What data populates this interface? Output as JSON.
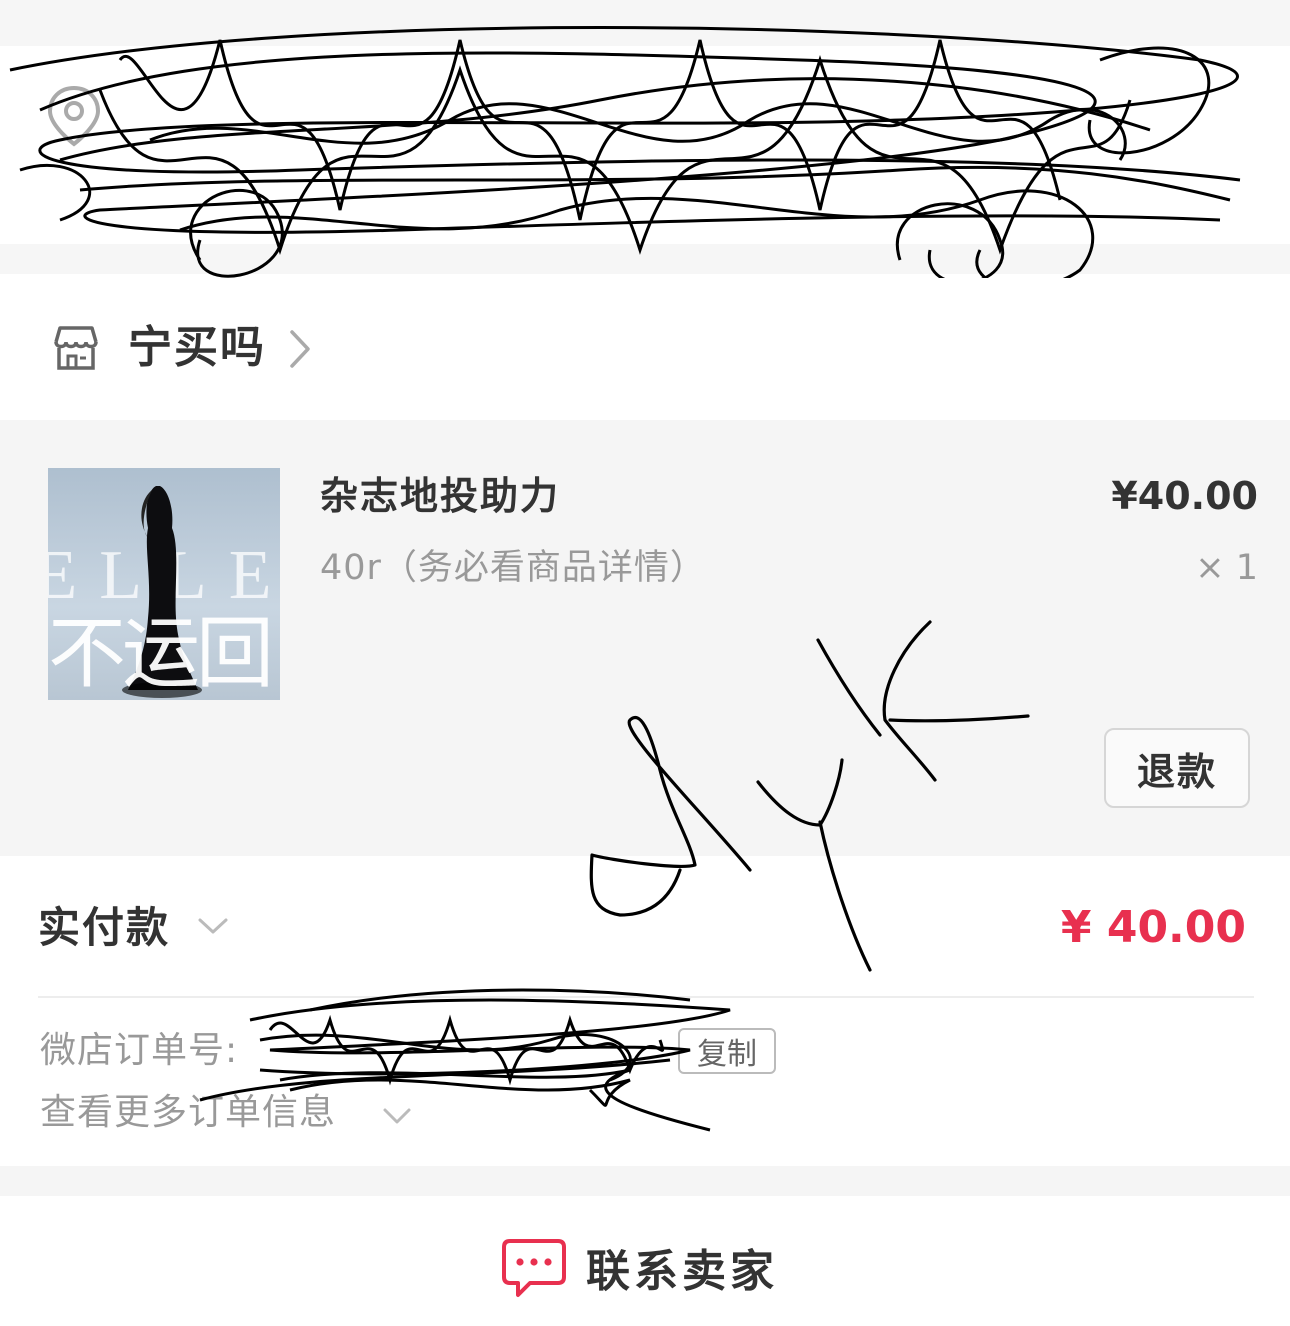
{
  "shop": {
    "name": "宁买吗"
  },
  "goods": {
    "title": "杂志地投助力",
    "spec": "40r（务必看商品详情）",
    "price": "¥40.00",
    "quantity": "× 1",
    "refund_label": "退款",
    "cover": {
      "logo_text": "ELLE",
      "overlay_text": "不运回"
    }
  },
  "payment": {
    "label": "实付款",
    "amount": "¥ 40.00",
    "accent_color": "#e8304f"
  },
  "order": {
    "number_label": "微店订单号:",
    "copy_label": "复制",
    "more_info_label": "查看更多订单信息"
  },
  "footer": {
    "contact_label": "联系卖家",
    "chat_icon_color": "#e8304f"
  },
  "icons": [
    "location-icon",
    "shop-icon",
    "chevron-right-icon",
    "chevron-down-icon",
    "chat-icon"
  ]
}
